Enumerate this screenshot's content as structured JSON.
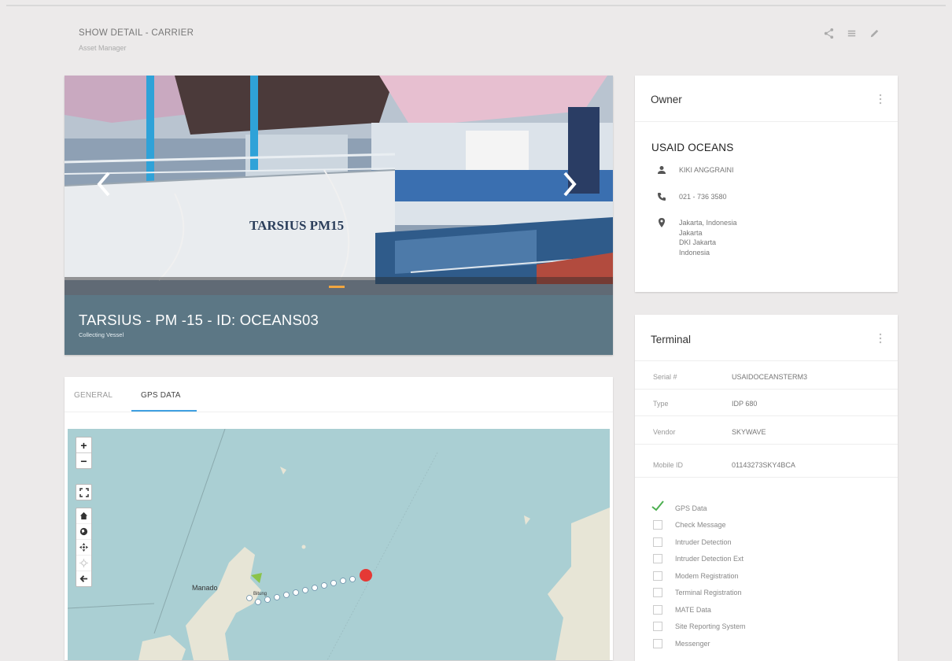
{
  "header": {
    "title": "SHOW DETAIL - CARRIER",
    "subtitle": "Asset Manager"
  },
  "header_actions": [
    "share-icon",
    "list-icon",
    "edit-icon"
  ],
  "vessel": {
    "title": "TARSIUS - PM -15 - ID: OCEANS03",
    "subtitle": "Collecting Vessel",
    "hull_text": "TARSIUS PM15"
  },
  "tabs": [
    {
      "label": "GENERAL",
      "active": false
    },
    {
      "label": "GPS DATA",
      "active": true
    }
  ],
  "map": {
    "zoom_in": "+",
    "zoom_out": "−",
    "place_label": "Manado",
    "place_label_small": "Bitung"
  },
  "owner": {
    "card_title": "Owner",
    "name": "USAID OCEANS",
    "contact": "KIKI ANGGRAINI",
    "phone": "021 - 736 3580",
    "address": [
      "Jakarta, Indonesia",
      "Jakarta",
      "DKI Jakarta",
      "Indonesia"
    ]
  },
  "terminal": {
    "card_title": "Terminal",
    "fields": [
      {
        "key": "Serial #",
        "value": "USAIDOCEANSTERM3"
      },
      {
        "key": "Type",
        "value": "IDP 680"
      },
      {
        "key": "Vendor",
        "value": "SKYWAVE"
      },
      {
        "key": "Mobile ID",
        "value": "01143273SKY4BCA"
      }
    ],
    "checks": [
      {
        "label": "GPS Data",
        "checked": true
      },
      {
        "label": "Check Message",
        "checked": false
      },
      {
        "label": "Intruder Detection",
        "checked": false
      },
      {
        "label": "Intruder Detection Ext",
        "checked": false
      },
      {
        "label": "Modem Registration",
        "checked": false
      },
      {
        "label": "Terminal Registration",
        "checked": false
      },
      {
        "label": "MATE Data",
        "checked": false
      },
      {
        "label": "Site Reporting System",
        "checked": false
      },
      {
        "label": "Messenger",
        "checked": false
      }
    ]
  },
  "colors": {
    "accent": "#3f9fe1",
    "hero_bg": "#5c7785",
    "indicator": "#f1a640",
    "marker_end": "#e53935",
    "check": "#4caf50"
  }
}
